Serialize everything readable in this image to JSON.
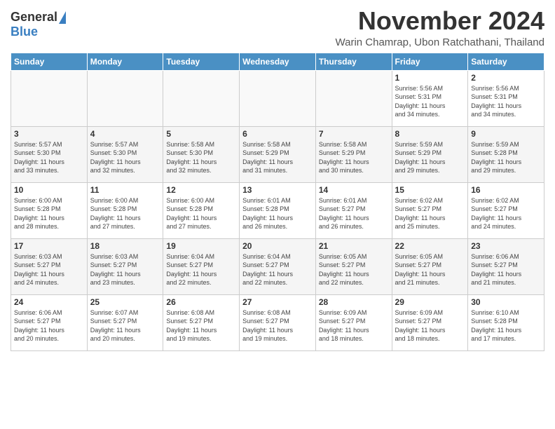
{
  "header": {
    "logo": {
      "general": "General",
      "blue": "Blue"
    },
    "title": "November 2024",
    "subtitle": "Warin Chamrap, Ubon Ratchathani, Thailand"
  },
  "calendar": {
    "days_of_week": [
      "Sunday",
      "Monday",
      "Tuesday",
      "Wednesday",
      "Thursday",
      "Friday",
      "Saturday"
    ],
    "weeks": [
      {
        "alt": false,
        "days": [
          {
            "num": "",
            "info": "",
            "empty": true
          },
          {
            "num": "",
            "info": "",
            "empty": true
          },
          {
            "num": "",
            "info": "",
            "empty": true
          },
          {
            "num": "",
            "info": "",
            "empty": true
          },
          {
            "num": "",
            "info": "",
            "empty": true
          },
          {
            "num": "1",
            "info": "Sunrise: 5:56 AM\nSunset: 5:31 PM\nDaylight: 11 hours\nand 34 minutes.",
            "empty": false
          },
          {
            "num": "2",
            "info": "Sunrise: 5:56 AM\nSunset: 5:31 PM\nDaylight: 11 hours\nand 34 minutes.",
            "empty": false
          }
        ]
      },
      {
        "alt": true,
        "days": [
          {
            "num": "3",
            "info": "Sunrise: 5:57 AM\nSunset: 5:30 PM\nDaylight: 11 hours\nand 33 minutes.",
            "empty": false
          },
          {
            "num": "4",
            "info": "Sunrise: 5:57 AM\nSunset: 5:30 PM\nDaylight: 11 hours\nand 32 minutes.",
            "empty": false
          },
          {
            "num": "5",
            "info": "Sunrise: 5:58 AM\nSunset: 5:30 PM\nDaylight: 11 hours\nand 32 minutes.",
            "empty": false
          },
          {
            "num": "6",
            "info": "Sunrise: 5:58 AM\nSunset: 5:29 PM\nDaylight: 11 hours\nand 31 minutes.",
            "empty": false
          },
          {
            "num": "7",
            "info": "Sunrise: 5:58 AM\nSunset: 5:29 PM\nDaylight: 11 hours\nand 30 minutes.",
            "empty": false
          },
          {
            "num": "8",
            "info": "Sunrise: 5:59 AM\nSunset: 5:29 PM\nDaylight: 11 hours\nand 29 minutes.",
            "empty": false
          },
          {
            "num": "9",
            "info": "Sunrise: 5:59 AM\nSunset: 5:28 PM\nDaylight: 11 hours\nand 29 minutes.",
            "empty": false
          }
        ]
      },
      {
        "alt": false,
        "days": [
          {
            "num": "10",
            "info": "Sunrise: 6:00 AM\nSunset: 5:28 PM\nDaylight: 11 hours\nand 28 minutes.",
            "empty": false
          },
          {
            "num": "11",
            "info": "Sunrise: 6:00 AM\nSunset: 5:28 PM\nDaylight: 11 hours\nand 27 minutes.",
            "empty": false
          },
          {
            "num": "12",
            "info": "Sunrise: 6:00 AM\nSunset: 5:28 PM\nDaylight: 11 hours\nand 27 minutes.",
            "empty": false
          },
          {
            "num": "13",
            "info": "Sunrise: 6:01 AM\nSunset: 5:28 PM\nDaylight: 11 hours\nand 26 minutes.",
            "empty": false
          },
          {
            "num": "14",
            "info": "Sunrise: 6:01 AM\nSunset: 5:27 PM\nDaylight: 11 hours\nand 26 minutes.",
            "empty": false
          },
          {
            "num": "15",
            "info": "Sunrise: 6:02 AM\nSunset: 5:27 PM\nDaylight: 11 hours\nand 25 minutes.",
            "empty": false
          },
          {
            "num": "16",
            "info": "Sunrise: 6:02 AM\nSunset: 5:27 PM\nDaylight: 11 hours\nand 24 minutes.",
            "empty": false
          }
        ]
      },
      {
        "alt": true,
        "days": [
          {
            "num": "17",
            "info": "Sunrise: 6:03 AM\nSunset: 5:27 PM\nDaylight: 11 hours\nand 24 minutes.",
            "empty": false
          },
          {
            "num": "18",
            "info": "Sunrise: 6:03 AM\nSunset: 5:27 PM\nDaylight: 11 hours\nand 23 minutes.",
            "empty": false
          },
          {
            "num": "19",
            "info": "Sunrise: 6:04 AM\nSunset: 5:27 PM\nDaylight: 11 hours\nand 22 minutes.",
            "empty": false
          },
          {
            "num": "20",
            "info": "Sunrise: 6:04 AM\nSunset: 5:27 PM\nDaylight: 11 hours\nand 22 minutes.",
            "empty": false
          },
          {
            "num": "21",
            "info": "Sunrise: 6:05 AM\nSunset: 5:27 PM\nDaylight: 11 hours\nand 22 minutes.",
            "empty": false
          },
          {
            "num": "22",
            "info": "Sunrise: 6:05 AM\nSunset: 5:27 PM\nDaylight: 11 hours\nand 21 minutes.",
            "empty": false
          },
          {
            "num": "23",
            "info": "Sunrise: 6:06 AM\nSunset: 5:27 PM\nDaylight: 11 hours\nand 21 minutes.",
            "empty": false
          }
        ]
      },
      {
        "alt": false,
        "days": [
          {
            "num": "24",
            "info": "Sunrise: 6:06 AM\nSunset: 5:27 PM\nDaylight: 11 hours\nand 20 minutes.",
            "empty": false
          },
          {
            "num": "25",
            "info": "Sunrise: 6:07 AM\nSunset: 5:27 PM\nDaylight: 11 hours\nand 20 minutes.",
            "empty": false
          },
          {
            "num": "26",
            "info": "Sunrise: 6:08 AM\nSunset: 5:27 PM\nDaylight: 11 hours\nand 19 minutes.",
            "empty": false
          },
          {
            "num": "27",
            "info": "Sunrise: 6:08 AM\nSunset: 5:27 PM\nDaylight: 11 hours\nand 19 minutes.",
            "empty": false
          },
          {
            "num": "28",
            "info": "Sunrise: 6:09 AM\nSunset: 5:27 PM\nDaylight: 11 hours\nand 18 minutes.",
            "empty": false
          },
          {
            "num": "29",
            "info": "Sunrise: 6:09 AM\nSunset: 5:27 PM\nDaylight: 11 hours\nand 18 minutes.",
            "empty": false
          },
          {
            "num": "30",
            "info": "Sunrise: 6:10 AM\nSunset: 5:28 PM\nDaylight: 11 hours\nand 17 minutes.",
            "empty": false
          }
        ]
      }
    ]
  }
}
